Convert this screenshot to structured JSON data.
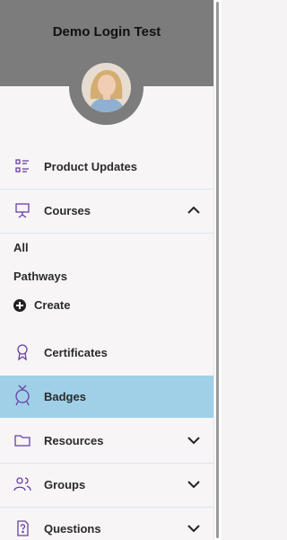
{
  "header": {
    "title": "Demo Login Test"
  },
  "nav": {
    "product_updates": "Product Updates",
    "courses": "Courses",
    "courses_sub": {
      "all": "All",
      "pathways": "Pathways",
      "create": "Create"
    },
    "certificates": "Certificates",
    "badges": "Badges",
    "resources": "Resources",
    "groups": "Groups",
    "questions": "Questions"
  },
  "colors": {
    "accent_icon": "#6a3da8",
    "active_bg": "#9fd0e7",
    "header_bg": "#7c7c7c"
  }
}
